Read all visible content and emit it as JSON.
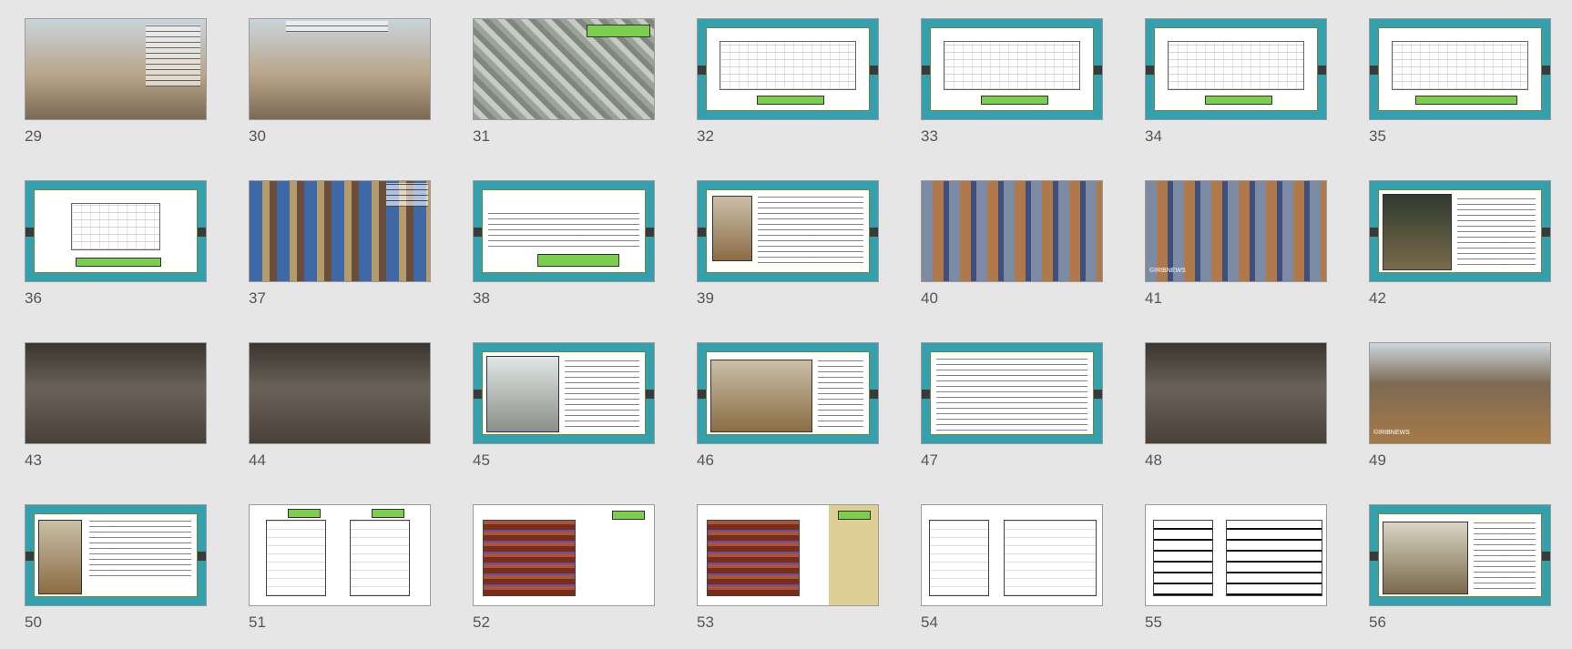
{
  "slides": [
    {
      "number": "29",
      "kind": "photo"
    },
    {
      "number": "30",
      "kind": "photo"
    },
    {
      "number": "31",
      "kind": "satellite"
    },
    {
      "number": "32",
      "kind": "plan-slide"
    },
    {
      "number": "33",
      "kind": "plan-slide"
    },
    {
      "number": "34",
      "kind": "plan-slide"
    },
    {
      "number": "35",
      "kind": "plan-slide"
    },
    {
      "number": "36",
      "kind": "plan-slide"
    },
    {
      "number": "37",
      "kind": "photo-tile"
    },
    {
      "number": "38",
      "kind": "text-slide"
    },
    {
      "number": "39",
      "kind": "text-slide"
    },
    {
      "number": "40",
      "kind": "photo-tile"
    },
    {
      "number": "41",
      "kind": "photo-tile",
      "watermark": "©IRIBNEWS"
    },
    {
      "number": "42",
      "kind": "text-slide"
    },
    {
      "number": "43",
      "kind": "photo-dark"
    },
    {
      "number": "44",
      "kind": "photo-dark"
    },
    {
      "number": "45",
      "kind": "text-slide"
    },
    {
      "number": "46",
      "kind": "text-slide"
    },
    {
      "number": "47",
      "kind": "text-slide"
    },
    {
      "number": "48",
      "kind": "photo-dark"
    },
    {
      "number": "49",
      "kind": "photo-veranda",
      "watermark": "©IRIBNEWS"
    },
    {
      "number": "50",
      "kind": "text-slide"
    },
    {
      "number": "51",
      "kind": "elevation-light"
    },
    {
      "number": "52",
      "kind": "elevation"
    },
    {
      "number": "53",
      "kind": "elevation-band"
    },
    {
      "number": "54",
      "kind": "elevation-light"
    },
    {
      "number": "55",
      "kind": "section"
    },
    {
      "number": "56",
      "kind": "text-slide"
    }
  ]
}
